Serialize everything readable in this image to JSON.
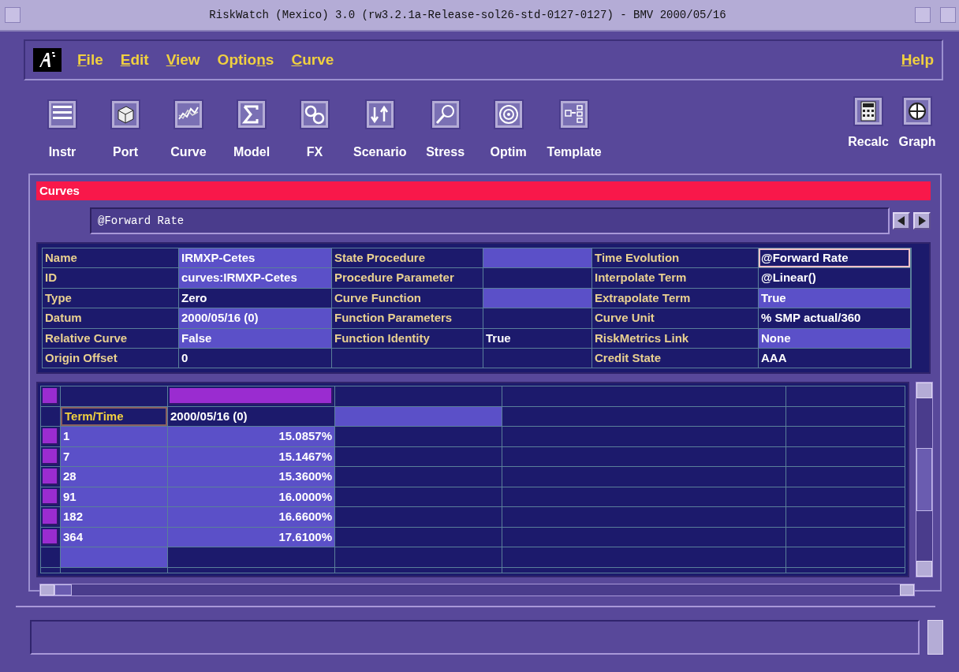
{
  "window": {
    "title": "RiskWatch (Mexico) 3.0 (rw3.2.1a-Release-sol26-std-0127-0127) - BMV 2000/05/16"
  },
  "menu": [
    {
      "key": "F",
      "rest": "ile"
    },
    {
      "key": "E",
      "rest": "dit"
    },
    {
      "key": "V",
      "rest": "iew"
    },
    {
      "lead": "Optio",
      "key": "n",
      "rest": "s"
    },
    {
      "key": "C",
      "rest": "urve"
    }
  ],
  "help_menu": {
    "key": "H",
    "rest": "elp"
  },
  "toolbar": [
    {
      "label": "Instr"
    },
    {
      "label": "Port"
    },
    {
      "label": "Curve"
    },
    {
      "label": "Model"
    },
    {
      "label": "FX"
    },
    {
      "label": "Scenario"
    },
    {
      "label": "Stress"
    },
    {
      "label": "Optim"
    },
    {
      "label": "Template"
    }
  ],
  "toolbar_right": [
    {
      "label": "Recalc"
    },
    {
      "label": "Graph"
    }
  ],
  "section": {
    "title": "Curves",
    "field_value": "@Forward Rate"
  },
  "properties": [
    {
      "cells": [
        {
          "label": "Name",
          "value": "IRMXP-Cetes",
          "highlighted": true
        },
        {
          "label": "State Procedure",
          "highlighted": true
        },
        {
          "label": "Time Evolution",
          "value": "@Forward Rate",
          "highlighted": false,
          "focused": true
        }
      ]
    },
    {
      "cells": [
        {
          "label": "ID",
          "value": "curves:IRMXP-Cetes",
          "highlighted": true
        },
        {
          "label": "Procedure Parameter",
          "highlighted": false
        },
        {
          "label": "Interpolate Term",
          "value": "@Linear()",
          "highlighted": false
        }
      ]
    },
    {
      "cells": [
        {
          "label": "Type",
          "value": "Zero",
          "highlighted": false
        },
        {
          "label": "Curve Function",
          "highlighted": true
        },
        {
          "label": "Extrapolate Term",
          "value": "True",
          "highlighted": true
        }
      ]
    },
    {
      "cells": [
        {
          "label": "Datum",
          "value": "2000/05/16 (0)",
          "highlighted": true
        },
        {
          "label": "Function Parameters",
          "highlighted": false
        },
        {
          "label": "Curve Unit",
          "value": "% SMP actual/360",
          "highlighted": false
        }
      ]
    },
    {
      "cells": [
        {
          "label": "Relative Curve",
          "value": "False",
          "highlighted": true
        },
        {
          "label": "Function Identity",
          "value": "True",
          "highlighted": false
        },
        {
          "label": "RiskMetrics Link",
          "value": "None",
          "highlighted": true
        }
      ]
    },
    {
      "cells": [
        {
          "label": "Origin Offset",
          "value": "0",
          "highlighted": false
        },
        {
          "highlighted": false
        },
        {
          "label": "Credit State",
          "value": "AAA",
          "highlighted": false
        }
      ]
    }
  ],
  "curve_table": {
    "columns": [
      "Term/Time",
      "2000/05/16 (0)"
    ],
    "rows": [
      {
        "term": "1",
        "rate": "15.0857%"
      },
      {
        "term": "7",
        "rate": "15.1467%"
      },
      {
        "term": "28",
        "rate": "15.3600%"
      },
      {
        "term": "91",
        "rate": "16.0000%"
      },
      {
        "term": "182",
        "rate": "16.6600%"
      },
      {
        "term": "364",
        "rate": "17.6100%"
      }
    ]
  }
}
